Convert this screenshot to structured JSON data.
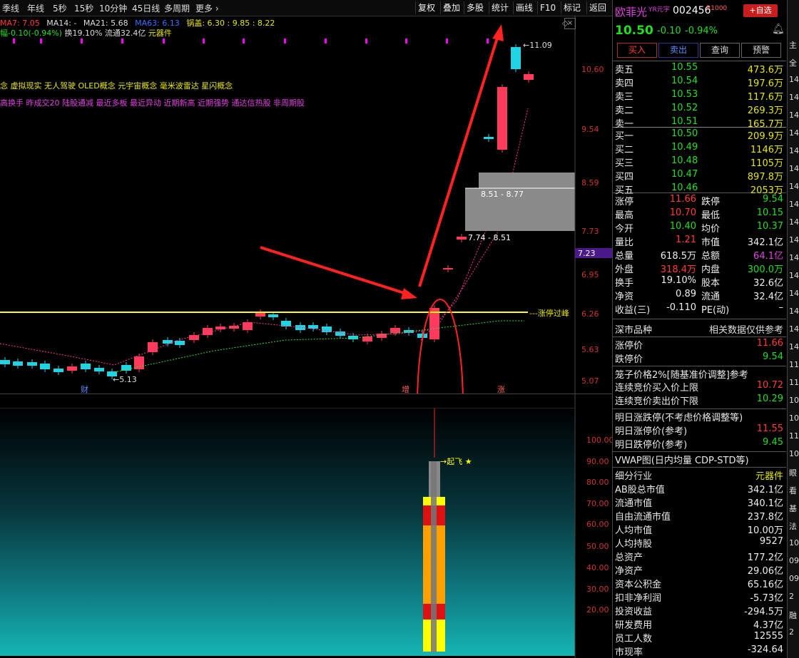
{
  "toolbar": {
    "periods": [
      "季线",
      "年线",
      "5秒",
      "15秒",
      "10分钟",
      "45日线",
      "多周期",
      "更多"
    ],
    "right_items": [
      "复权",
      "叠加",
      "多股",
      "统计",
      "画线",
      "F10",
      "标记",
      "返回"
    ]
  },
  "ma": {
    "ma7": "MA7: 7.05",
    "ma14": "MA14: -",
    "ma21": "MA21: 5.68",
    "ma63": "MA63: 6.13",
    "guogai": "锅盖: 6.30 : 9.85 : 8.22"
  },
  "info_line": {
    "change": "幅-0.10(-0.94%)",
    "turnover": "换19.10%",
    "float": "流通32.4亿",
    "industry": "元器件"
  },
  "concepts": {
    "line1": "念 虚拟现实 无人驾驶 OLED概念 元宇宙概念 毫米波雷达 星闪概念",
    "line2": "高换手 昨成交20 陆股通减 最近多板 最近异动 近期新高 近期强势 通达信热股 非周期股"
  },
  "chart_labels": {
    "high": "11.09",
    "low": "5.13",
    "gap1": "8.51 - 8.77",
    "gap2": "7.74 - 8.51",
    "limit_line": "涨停过峰",
    "marker_cai": "财",
    "marker_zeng": "增",
    "marker_zhang": "涨",
    "current_price_tag": "7.23",
    "qifei": "起飞"
  },
  "price_axis": [
    "10.60",
    "9.54",
    "8.59",
    "7.73",
    "6.95",
    "6.26",
    "5.63",
    "5.07"
  ],
  "lower_axis": [
    "100.00",
    "90.00",
    "80.00",
    "70.00",
    "60.00",
    "50.00",
    "40.00",
    "30.00",
    "20.00"
  ],
  "stock": {
    "name": "欧菲光",
    "tag1": "YR元宇",
    "code": "002456",
    "tag2": "R1000",
    "add_btn": "+自选",
    "price": "10.50",
    "change": "-0.10",
    "pct": "-0.94%"
  },
  "trade_buttons": [
    "买入",
    "卖出",
    "查询",
    "预警"
  ],
  "sell_orders": [
    {
      "label": "卖五",
      "price": "10.55",
      "vol": "473.6万"
    },
    {
      "label": "卖四",
      "price": "10.54",
      "vol": "197.6万"
    },
    {
      "label": "卖三",
      "price": "10.53",
      "vol": "117.6万"
    },
    {
      "label": "卖二",
      "price": "10.52",
      "vol": "269.3万"
    },
    {
      "label": "卖一",
      "price": "10.51",
      "vol": "165.7万"
    }
  ],
  "buy_orders": [
    {
      "label": "买一",
      "price": "10.50",
      "vol": "209.9万"
    },
    {
      "label": "买二",
      "price": "10.49",
      "vol": "1146万"
    },
    {
      "label": "买三",
      "price": "10.48",
      "vol": "1105万"
    },
    {
      "label": "买四",
      "price": "10.47",
      "vol": "897.8万"
    },
    {
      "label": "买五",
      "price": "10.46",
      "vol": "2053万"
    }
  ],
  "stats": [
    {
      "l1": "涨停",
      "v1": "11.66",
      "c1": "red",
      "l2": "跌停",
      "v2": "9.54",
      "c2": "green"
    },
    {
      "l1": "最高",
      "v1": "10.70",
      "c1": "red",
      "l2": "最低",
      "v2": "10.15",
      "c2": "green"
    },
    {
      "l1": "今开",
      "v1": "10.40",
      "c1": "green",
      "l2": "均价",
      "v2": "10.37",
      "c2": "green"
    },
    {
      "l1": "量比",
      "v1": "1.21",
      "c1": "red",
      "l2": "市值",
      "v2": "342.1亿",
      "c2": "white"
    },
    {
      "l1": "总量",
      "v1": "618.5万",
      "c1": "white",
      "l2": "总额",
      "v2": "64.1亿",
      "c2": "mag"
    },
    {
      "l1": "外盘",
      "v1": "318.4万",
      "c1": "red",
      "l2": "内盘",
      "v2": "300.0万",
      "c2": "green"
    },
    {
      "l1": "换手",
      "v1": "19.10%",
      "c1": "white",
      "l2": "股本",
      "v2": "32.6亿",
      "c2": "white"
    },
    {
      "l1": "净资",
      "v1": "0.89",
      "c1": "white",
      "l2": "流通",
      "v2": "32.4亿",
      "c2": "white"
    },
    {
      "l1": "收益(三)",
      "v1": "-0.110",
      "c1": "white",
      "l2": "PE(动)",
      "v2": "–",
      "c2": "white"
    }
  ],
  "market_section": {
    "left": "深市品种",
    "right": "相关数据仅供参考"
  },
  "limit_prices": [
    {
      "label": "涨停价",
      "value": "11.66",
      "color": "red"
    },
    {
      "label": "跌停价",
      "value": "9.54",
      "color": "green"
    }
  ],
  "cage": {
    "title": "笼子价格2%[随基准价调整]参考",
    "rows": [
      {
        "label": "连续竞价买入价上限",
        "value": "10.72",
        "color": "red"
      },
      {
        "label": "连续竞价卖出价下限",
        "value": "10.29",
        "color": "green"
      }
    ]
  },
  "tomorrow": {
    "title": "明日涨跌停(不考虑价格调整等)",
    "rows": [
      {
        "label": "明日涨停价(参考)",
        "value": "11.55",
        "color": "red"
      },
      {
        "label": "明日跌停价(参考)",
        "value": "9.45",
        "color": "green"
      }
    ]
  },
  "vwap": "VWAP图(日内均量 CDP-STD等)",
  "fundamentals": [
    {
      "label": "细分行业",
      "value": "元器件",
      "color": "yellow"
    },
    {
      "label": "AB股总市值",
      "value": "342.1亿",
      "color": "white"
    },
    {
      "label": "流通市值",
      "value": "340.1亿",
      "color": "white"
    },
    {
      "label": "自由流通市值",
      "value": "237.8亿",
      "color": "white"
    },
    {
      "label": "人均市值",
      "value": "10.00万",
      "color": "white"
    },
    {
      "label": "人均持股",
      "value": "9527",
      "color": "white"
    },
    {
      "label": "总资产",
      "value": "177.2亿",
      "color": "white"
    },
    {
      "label": "净资产",
      "value": "29.06亿",
      "color": "white"
    },
    {
      "label": "资本公积金",
      "value": "65.16亿",
      "color": "white"
    },
    {
      "label": "扣非净利润",
      "value": "-5.73亿",
      "color": "white"
    },
    {
      "label": "投资收益",
      "value": "-294.5万",
      "color": "white"
    },
    {
      "label": "研发费用",
      "value": "4.37亿",
      "color": "white"
    },
    {
      "label": "员工人数",
      "value": "12555",
      "color": "white"
    },
    {
      "label": "市现率",
      "value": "-324.64",
      "color": "white"
    }
  ],
  "far_right": [
    "主",
    "全",
    "14",
    "14",
    "14",
    "14",
    "14",
    "14",
    "14",
    "14",
    "14",
    "14",
    "14",
    "14",
    "14",
    "14",
    "14",
    "14",
    "11",
    "11",
    "10",
    "10",
    "11",
    "10",
    "眼",
    "看",
    "基",
    "法",
    "10",
    "09",
    "09",
    "2",
    "融",
    "2"
  ],
  "colors": {
    "up": "#ff3b3b",
    "down": "#22d3d3",
    "yellow_line": "#ffff00",
    "magenta": "#ff00ff"
  }
}
